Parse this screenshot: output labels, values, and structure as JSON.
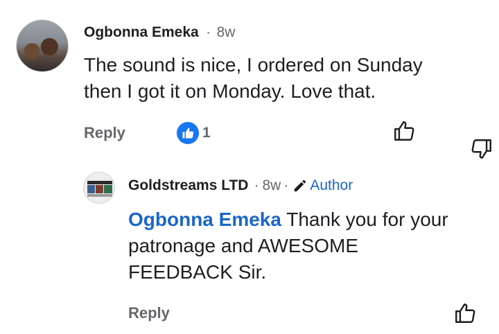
{
  "comment": {
    "author": "Ogbonna Emeka",
    "time": "8w",
    "text_line1": "The sound is nice, I ordered on Sunday",
    "text_line2": "then I got it on Monday. Love that.",
    "reply_label": "Reply",
    "like_count": "1"
  },
  "reply": {
    "author": "Goldstreams LTD",
    "time": "8w",
    "author_badge": "Author",
    "mention": "Ogbonna Emeka",
    "text_line1_rest": " Thank you for your",
    "text_line2": "patronage and AWESOME",
    "text_line3": "FEEDBACK Sir.",
    "reply_label": "Reply"
  },
  "separator": "·",
  "colors": {
    "accent": "#1877f2",
    "link": "#1a66c9",
    "muted": "#65676b"
  },
  "icons": [
    "thumbs-up-icon",
    "thumbs-down-icon",
    "like-reaction-icon",
    "pencil-icon"
  ]
}
